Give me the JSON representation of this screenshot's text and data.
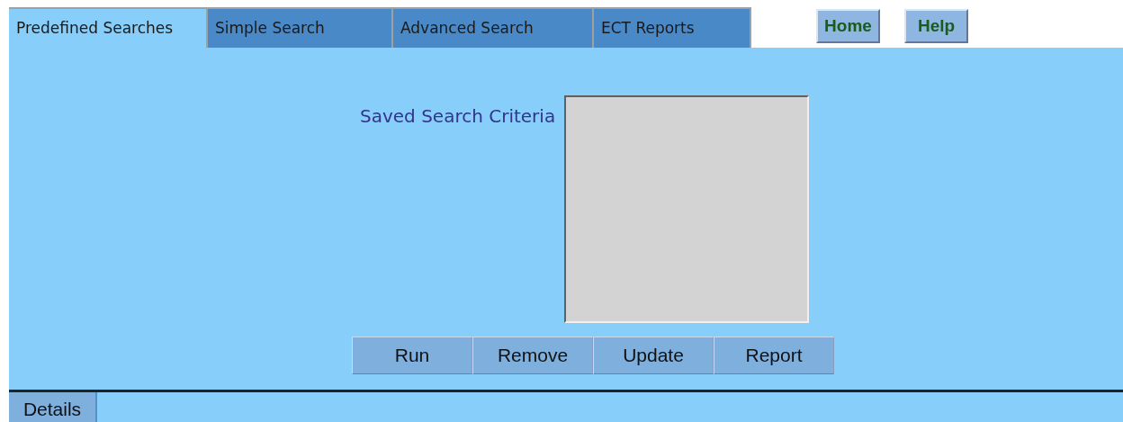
{
  "tabs": [
    {
      "label": "Predefined Searches",
      "selected": true
    },
    {
      "label": "Simple Search",
      "selected": false
    },
    {
      "label": "Advanced Search",
      "selected": false
    },
    {
      "label": "ECT Reports",
      "selected": false
    }
  ],
  "nav_buttons": [
    "Home",
    "Help"
  ],
  "saved_search": {
    "label": "Saved Search Criteria"
  },
  "actions": [
    "Run",
    "Remove",
    "Update",
    "Report"
  ],
  "bottom_tabs": [
    {
      "label": "Details",
      "selected": true
    }
  ]
}
